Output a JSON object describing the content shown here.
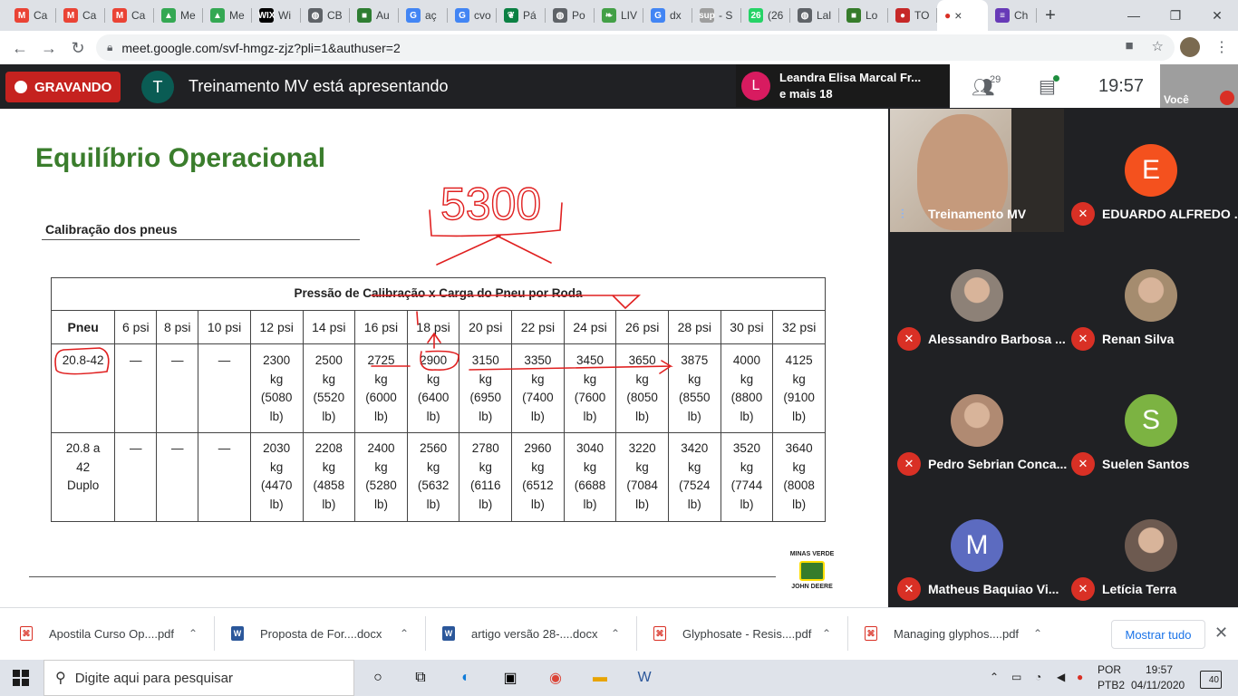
{
  "browser": {
    "tabs": [
      {
        "label": "Ca",
        "icon": "gmail-icon",
        "color": "#ea4335",
        "glyph": "M"
      },
      {
        "label": "Ca",
        "icon": "gmail-icon",
        "color": "#ea4335",
        "glyph": "M"
      },
      {
        "label": "Ca",
        "icon": "gmail-icon",
        "color": "#ea4335",
        "glyph": "M"
      },
      {
        "label": "Me",
        "icon": "drive-icon",
        "color": "#34a853",
        "glyph": "▲"
      },
      {
        "label": "Me",
        "icon": "drive-icon",
        "color": "#34a853",
        "glyph": "▲"
      },
      {
        "label": "Wi",
        "icon": "wix-icon",
        "color": "#000000",
        "glyph": "WIX"
      },
      {
        "label": "CB",
        "icon": "globe-icon",
        "color": "#5f6368",
        "glyph": "◍"
      },
      {
        "label": "Au",
        "icon": "flag-icon",
        "color": "#2e7d32",
        "glyph": "■"
      },
      {
        "label": "aç",
        "icon": "google-icon",
        "color": "#4285f4",
        "glyph": "G"
      },
      {
        "label": "cvo",
        "icon": "google-icon",
        "color": "#4285f4",
        "glyph": "G"
      },
      {
        "label": "Pá",
        "icon": "leaf-icon",
        "color": "#0b8043",
        "glyph": "❦"
      },
      {
        "label": "Po",
        "icon": "globe-icon",
        "color": "#5f6368",
        "glyph": "◍"
      },
      {
        "label": "LIV",
        "icon": "leaf-icon",
        "color": "#43a047",
        "glyph": "❧"
      },
      {
        "label": "dx",
        "icon": "google-icon",
        "color": "#4285f4",
        "glyph": "G"
      },
      {
        "label": "- S",
        "icon": "sup-icon",
        "color": "#9e9e9e",
        "glyph": "sup"
      },
      {
        "label": "(26",
        "icon": "whatsapp-icon",
        "color": "#25d366",
        "glyph": "26"
      },
      {
        "label": "Lal",
        "icon": "globe-icon",
        "color": "#5f6368",
        "glyph": "◍"
      },
      {
        "label": "Lo",
        "icon": "deere-icon",
        "color": "#367c2b",
        "glyph": "■"
      },
      {
        "label": "TO",
        "icon": "record-icon",
        "color": "#c62828",
        "glyph": "●"
      }
    ],
    "active_tab": {
      "label": "●",
      "close": "×"
    },
    "last_tab": {
      "label": "Ch",
      "icon": "forms-icon",
      "color": "#673ab7",
      "glyph": "≡"
    },
    "new_tab": "+",
    "url": "meet.google.com/svf-hmgz-zjz?pli=1&authuser=2"
  },
  "meet": {
    "recording_label": "GRAVANDO",
    "presenter_initial": "T",
    "presenting_text": "Treinamento MV está apresentando",
    "notification": {
      "initial": "L",
      "line1": "Leandra Elisa Marcal Fr...",
      "line2": "e mais 18"
    },
    "people_count": "29",
    "time": "19:57",
    "self_label": "Você",
    "main_video_name": "Treinamento MV",
    "participants": [
      {
        "name": "EDUARDO ALFREDO ...",
        "initial": "E",
        "color": "#f4511e",
        "photo": false
      },
      {
        "name": "Alessandro Barbosa ...",
        "initial": "",
        "color": "#8d8177",
        "photo": true
      },
      {
        "name": "Renan Silva",
        "initial": "",
        "color": "#a58c6f",
        "photo": true
      },
      {
        "name": "Pedro Sebrian Conca...",
        "initial": "",
        "color": "#b08a72",
        "photo": true
      },
      {
        "name": "Suelen Santos",
        "initial": "S",
        "color": "#7cb342",
        "photo": false
      },
      {
        "name": "Matheus Baquiao Vi...",
        "initial": "M",
        "color": "#5c6bc0",
        "photo": false
      },
      {
        "name": "Letícia Terra",
        "initial": "",
        "color": "#6d5a50",
        "photo": true
      }
    ]
  },
  "slide": {
    "title": "Equilíbrio Operacional",
    "subtitle": "Calibração dos pneus",
    "table_caption": "Pressão de Calibração x Carga do Pneu por Roda",
    "headers": [
      "Pneu",
      "6 psi",
      "8 psi",
      "10 psi",
      "12 psi",
      "14 psi",
      "16 psi",
      "18 psi",
      "20 psi",
      "22 psi",
      "24 psi",
      "26 psi",
      "28 psi",
      "30 psi",
      "32 psi"
    ],
    "rows": [
      [
        "20.8-42",
        "—",
        "—",
        "—",
        "2300\nkg\n(5080\nlb)",
        "2500\nkg\n(5520\nlb)",
        "2725\nkg\n(6000\nlb)",
        "2900\nkg\n(6400\nlb)",
        "3150\nkg\n(6950\nlb)",
        "3350\nkg\n(7400\nlb)",
        "3450\nkg\n(7600\nlb)",
        "3650\nkg\n(8050\nlb)",
        "3875\nkg\n(8550\nlb)",
        "4000\nkg\n(8800\nlb)",
        "4125\nkg\n(9100\nlb)"
      ],
      [
        "20.8 a\n42\nDuplo",
        "—",
        "—",
        "—",
        "2030\nkg\n(4470\nlb)",
        "2208\nkg\n(4858\nlb)",
        "2400\nkg\n(5280\nlb)",
        "2560\nkg\n(5632\nlb)",
        "2780\nkg\n(6116\nlb)",
        "2960\nkg\n(6512\nlb)",
        "3040\nkg\n(6688\nlb)",
        "3220\nkg\n(7084\nlb)",
        "3420\nkg\n(7524\nlb)",
        "3520\nkg\n(7744\nlb)",
        "3640\nkg\n(8008\nlb)"
      ]
    ],
    "handwritten_note": "5300",
    "logo_top": "MINAS VERDE",
    "logo_bottom": "JOHN DEERE"
  },
  "downloads": {
    "items": [
      {
        "name": "Apostila Curso Op....pdf",
        "type": "pdf"
      },
      {
        "name": "Proposta de For....docx",
        "type": "docx"
      },
      {
        "name": "artigo versão 28-....docx",
        "type": "docx"
      },
      {
        "name": "Glyphosate - Resis....pdf",
        "type": "pdf"
      },
      {
        "name": "Managing glyphos....pdf",
        "type": "pdf"
      }
    ],
    "show_all": "Mostrar tudo"
  },
  "taskbar": {
    "search_placeholder": "Digite aqui para pesquisar",
    "lang1": "POR",
    "lang2": "PTB2",
    "time": "19:57",
    "date": "04/11/2020",
    "notifications": "40"
  }
}
